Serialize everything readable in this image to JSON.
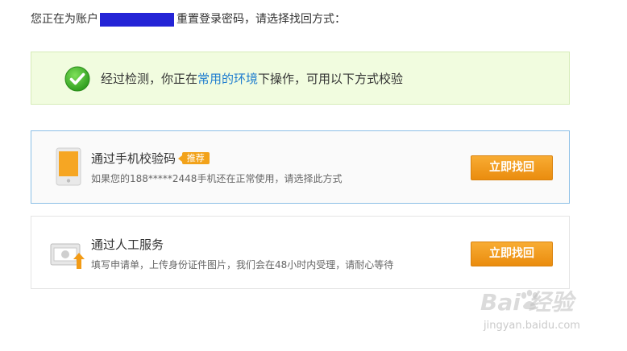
{
  "header": {
    "prefix": "您正在为账户",
    "suffix": "重置登录密码，请选择找回方式："
  },
  "notice": {
    "text_before": "经过检测，你正在",
    "highlight": "常用的环境",
    "text_after": "下操作，可用以下方式校验",
    "icon": "check-circle-icon",
    "colors": {
      "background": "#f1fcdf",
      "highlight": "#1f7dcf",
      "check": "#3fb62a"
    }
  },
  "options": [
    {
      "title": "通过手机校验码",
      "badge": "推荐",
      "description": "如果您的188*****2448手机还在正常使用，请选择此方式",
      "button": "立即找回",
      "icon": "phone-icon"
    },
    {
      "title": "通过人工服务",
      "description": "填写申请单，上传身份证件图片，我们会在48小时内受理，请耐心等待",
      "button": "立即找回",
      "icon": "id-upload-icon"
    }
  ],
  "watermark": {
    "main": "Bai  经验",
    "sub": "jingyan.baidu.com"
  },
  "colors": {
    "accent": "#f2a21a",
    "account_mask": "#2424d6",
    "selected_border": "#8cbfe6"
  }
}
